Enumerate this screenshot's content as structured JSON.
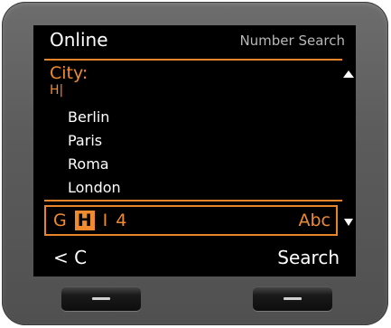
{
  "header": {
    "title": "Online",
    "subtitle": "Number Search"
  },
  "field": {
    "label": "City:",
    "value": "H|"
  },
  "list": {
    "items": [
      "Berlin",
      "Paris",
      "Roma",
      "London"
    ]
  },
  "input_bar": {
    "keys": [
      "G",
      "H",
      "I",
      "4"
    ],
    "active_key": "H",
    "mode": "Abc"
  },
  "softkeys": {
    "left": "< C",
    "right": "Search"
  },
  "icons": {
    "scroll_up": "triangle-up-icon",
    "scroll_down": "triangle-down-icon"
  },
  "colors": {
    "accent": "#f08a2e",
    "screen_bg": "#000000",
    "device_body": "#5c5c5c"
  }
}
